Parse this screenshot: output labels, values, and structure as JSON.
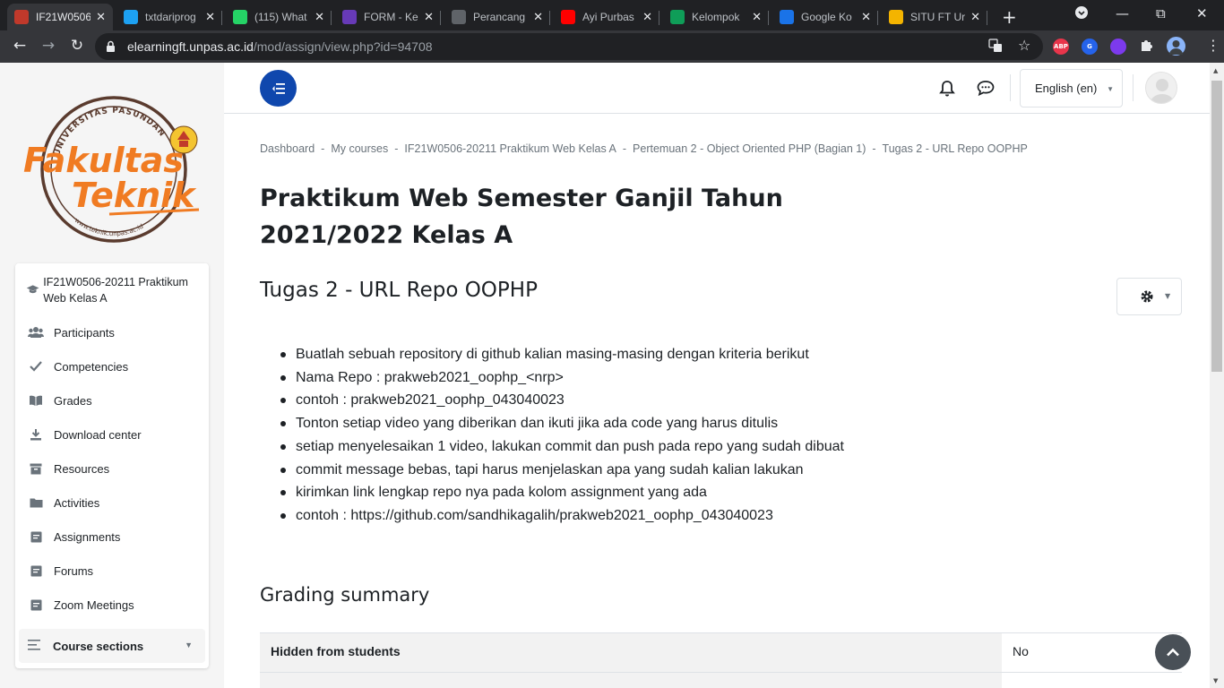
{
  "browser": {
    "tabs": [
      {
        "title": "IF21W0506",
        "favicon": "moodle-icon",
        "color": "#c0392b",
        "active": true
      },
      {
        "title": "txtdariprog",
        "favicon": "twitter-icon",
        "color": "#1da1f2",
        "active": false
      },
      {
        "title": "(115) What",
        "favicon": "whatsapp-icon",
        "color": "#25d366",
        "active": false
      },
      {
        "title": "FORM - Ke",
        "favicon": "forms-icon",
        "color": "#673ab7",
        "active": false
      },
      {
        "title": "Perancang",
        "favicon": "globe-icon",
        "color": "#5f6368",
        "active": false
      },
      {
        "title": "Ayi Purbas",
        "favicon": "youtube-icon",
        "color": "#ff0000",
        "active": false
      },
      {
        "title": "Kelompok",
        "favicon": "sheets-icon",
        "color": "#0f9d58",
        "active": false
      },
      {
        "title": "Google Ko",
        "favicon": "contacts-icon",
        "color": "#1a73e8",
        "active": false
      },
      {
        "title": "SITU FT Ur",
        "favicon": "unpas-icon",
        "color": "#f4b400",
        "active": false
      }
    ],
    "url_domain": "elearningft.unpas.ac.id",
    "url_path": "/mod/assign/view.php?id=94708",
    "extensions": [
      {
        "label": "ABP",
        "color": "#e8354b"
      },
      {
        "label": "G",
        "color": "#2563eb"
      },
      {
        "label": "",
        "color": "#7c3aed"
      }
    ]
  },
  "sidebar": {
    "logo": {
      "ring_text": "UNIVERSITAS PASUNDAN",
      "line1": "Fakultas",
      "line2": "Teknik",
      "web": "www.teknik.unpas.ac.id"
    },
    "course_label": "IF21W0506-20211 Praktikum Web Kelas A",
    "items": [
      {
        "label": "Participants",
        "icon": "users-icon"
      },
      {
        "label": "Competencies",
        "icon": "check-icon"
      },
      {
        "label": "Grades",
        "icon": "book-icon"
      },
      {
        "label": "Download center",
        "icon": "download-icon"
      },
      {
        "label": "Resources",
        "icon": "archive-icon"
      },
      {
        "label": "Activities",
        "icon": "folder-icon"
      },
      {
        "label": "Assignments",
        "icon": "file-icon"
      },
      {
        "label": "Forums",
        "icon": "file-icon"
      },
      {
        "label": "Zoom Meetings",
        "icon": "file-icon"
      }
    ],
    "sections_label": "Course sections"
  },
  "header": {
    "language": "English (en)"
  },
  "breadcrumb": [
    "Dashboard",
    "My courses",
    "IF21W0506-20211 Praktikum Web Kelas A",
    "Pertemuan 2 - Object Oriented PHP (Bagian 1)",
    "Tugas 2 - URL Repo OOPHP"
  ],
  "main": {
    "course_title_line1": "Praktikum Web Semester Ganjil Tahun",
    "course_title_line2": "2021/2022 Kelas A",
    "assignment_title": "Tugas 2 - URL Repo OOPHP",
    "intro": [
      "Buatlah sebuah repository di github kalian masing-masing dengan kriteria berikut",
      "Nama Repo : prakweb2021_oophp_<nrp>",
      "contoh : prakweb2021_oophp_043040023",
      "Tonton setiap video yang diberikan dan ikuti jika ada code yang harus ditulis",
      "setiap menyelesaikan 1 video, lakukan commit dan push pada repo yang sudah dibuat",
      "commit message bebas, tapi harus menjelaskan apa yang sudah kalian lakukan",
      "kirimkan link lengkap repo nya pada kolom assignment yang ada",
      "contoh : https://github.com/sandhikagalih/prakweb2021_oophp_043040023"
    ],
    "grading_title": "Grading summary",
    "grading_rows": [
      {
        "label": "Hidden from students",
        "value": "No"
      },
      {
        "label": "",
        "value": ""
      }
    ]
  },
  "colors": {
    "brand_blue": "#0f47ad",
    "logo_orange": "#f07b22",
    "logo_brown": "#5a3b2e"
  }
}
